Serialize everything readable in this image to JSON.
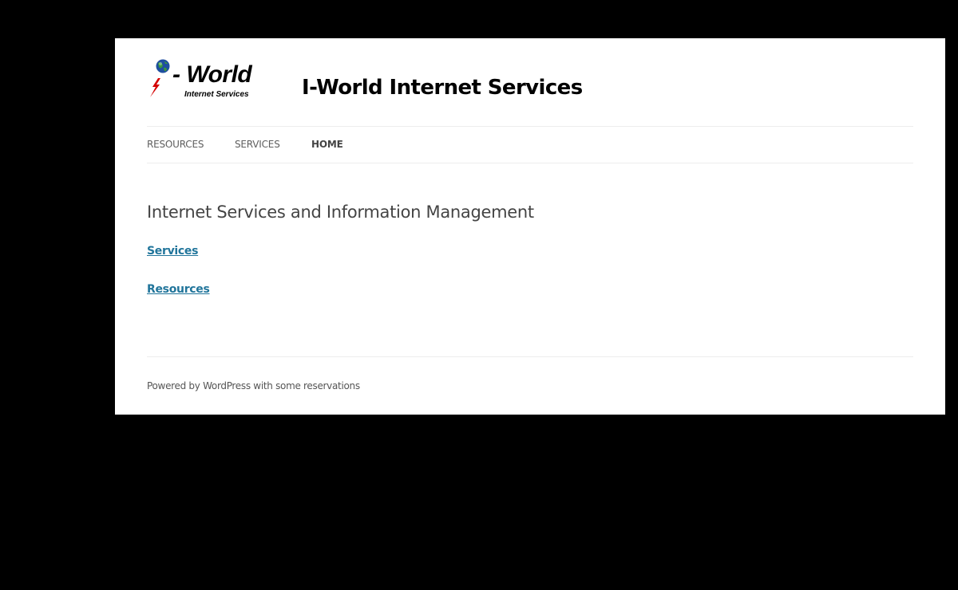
{
  "header": {
    "logo": {
      "word": "- World",
      "subtitle": "Internet Services",
      "icons": [
        "globe-icon",
        "lightning-bolt-icon"
      ]
    },
    "site_title": "I-World Internet Services"
  },
  "nav": {
    "items": [
      {
        "label": "RESOURCES"
      },
      {
        "label": "SERVICES"
      },
      {
        "label": "HOME"
      }
    ],
    "current": "HOME"
  },
  "main": {
    "heading": "Internet Services and Information Management",
    "links": [
      {
        "label": "Services"
      },
      {
        "label": "Resources"
      }
    ]
  },
  "footer": {
    "text": "Powered by WordPress with some reservations"
  },
  "colors": {
    "background": "#000000",
    "page": "#ffffff",
    "link": "#21759b",
    "nav_text": "#5e5e5e",
    "heading_text": "#444444",
    "divider": "#ededed",
    "logo_bolt": "#d40000",
    "logo_globe": "#1f4fa0"
  }
}
